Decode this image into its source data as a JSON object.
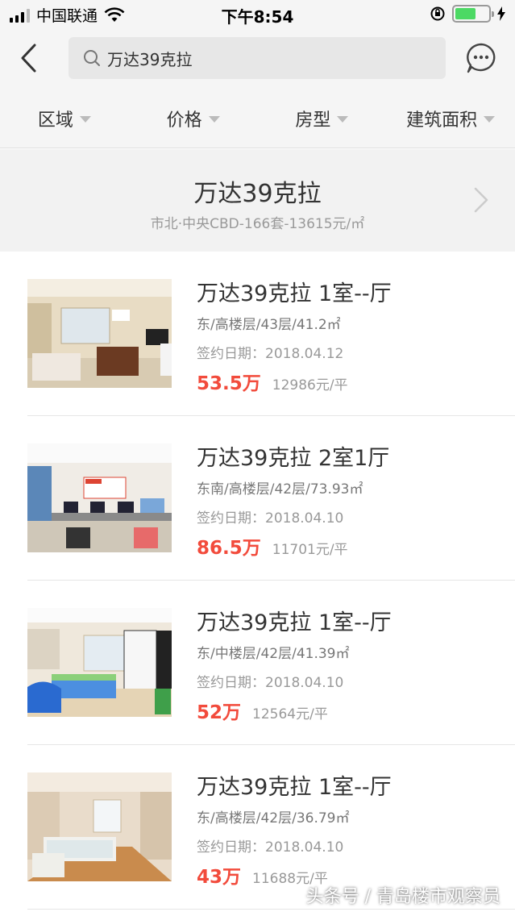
{
  "status_bar": {
    "carrier": "中国联通",
    "time": "下午8:54"
  },
  "search": {
    "query": "万达39克拉"
  },
  "filters": [
    {
      "label": "区域"
    },
    {
      "label": "价格"
    },
    {
      "label": "房型"
    },
    {
      "label": "建筑面积"
    }
  ],
  "community": {
    "name": "万达39克拉",
    "info": "市北·中央CBD-166套-13615元/㎡"
  },
  "listings": [
    {
      "title": "万达39克拉 1室--厅",
      "attrs": "东/高楼层/43层/41.2㎡",
      "date": "签约日期：2018.04.12",
      "price_total": "53.5万",
      "price_unit": "12986元/平"
    },
    {
      "title": "万达39克拉 2室1厅",
      "attrs": "东南/高楼层/42层/73.93㎡",
      "date": "签约日期：2018.04.10",
      "price_total": "86.5万",
      "price_unit": "11701元/平"
    },
    {
      "title": "万达39克拉 1室--厅",
      "attrs": "东/中楼层/42层/41.39㎡",
      "date": "签约日期：2018.04.10",
      "price_total": "52万",
      "price_unit": "12564元/平"
    },
    {
      "title": "万达39克拉 1室--厅",
      "attrs": "东/高楼层/42层/36.79㎡",
      "date": "签约日期：2018.04.10",
      "price_total": "43万",
      "price_unit": "11688元/平"
    }
  ],
  "watermark": "头条号 / 青岛楼市观察员",
  "colors": {
    "accent_red": "#f24b3c",
    "background_gray": "#f5f5f5"
  }
}
